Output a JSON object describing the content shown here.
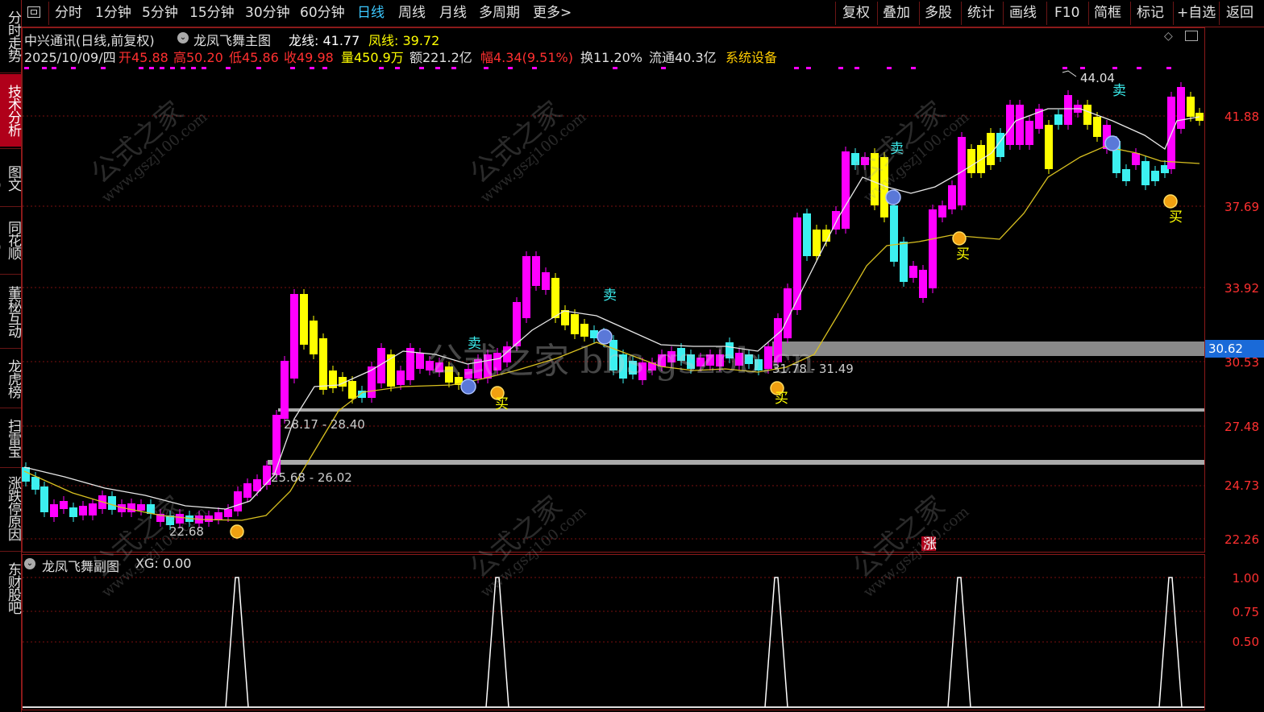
{
  "toolbar": {
    "periods": [
      "分时",
      "1分钟",
      "5分钟",
      "15分钟",
      "30分钟",
      "60分钟",
      "日线",
      "周线",
      "月线",
      "多周期",
      "更多>"
    ],
    "active_period": "日线",
    "right_items": [
      "复权",
      "叠加",
      "多股",
      "统计",
      "画线",
      "F10",
      "简框",
      "标记",
      "+自选",
      "返回"
    ]
  },
  "left_tabs": [
    "分时走势",
    "技术分析",
    "图文10",
    "同花顺10",
    "董秘互动",
    "龙虎榜",
    "扫雷宝",
    "涨跌停原因",
    "东财股吧"
  ],
  "left_tab_active": "技术分析",
  "header": {
    "stock_name": "中兴通讯(日线,前复权)",
    "indicator_name": "龙凤飞舞主图",
    "dragon_label": "龙线: 41.77",
    "phoenix_label": "凤线: 39.72",
    "date": "2025/10/09/四",
    "open": "开45.88",
    "high": "高50.20",
    "low": "低45.86",
    "close": "收49.98",
    "volume": "量450.9万",
    "amount": "额221.2亿",
    "change": "幅4.34(9.51%)",
    "turnover": "换11.20%",
    "float_cap": "流通40.3亿",
    "sector": "系统设备"
  },
  "price_axis": [
    "41.88",
    "37.69",
    "33.92",
    "30.53",
    "27.48",
    "24.73",
    "22.26"
  ],
  "current_price": "30.62",
  "annotations": {
    "high_mark": "44.04",
    "range_1": "28.17 - 28.40",
    "range_2": "25.68 - 26.02",
    "range_3": "31.78 - 31.49",
    "low_mark": "22.68"
  },
  "signals": {
    "buy": "买",
    "sell": "卖",
    "limit": "涨"
  },
  "sub_chart": {
    "title": "龙凤飞舞副图",
    "xg_label": "XG: 0.00",
    "axis": [
      "1.00",
      "0.75",
      "0.50"
    ]
  },
  "watermark": {
    "site_cn": "公式之家",
    "site_url": "www.gszj100.com",
    "center": "公式之家 bbs.gszbb.cn"
  },
  "colors": {
    "up": "#ff00ff",
    "down": "#3cf0f0",
    "yellow": "#ffff00",
    "grid": "#8b1a1a",
    "axis_text": "#ff3030",
    "active": "#3cc8ff"
  }
}
